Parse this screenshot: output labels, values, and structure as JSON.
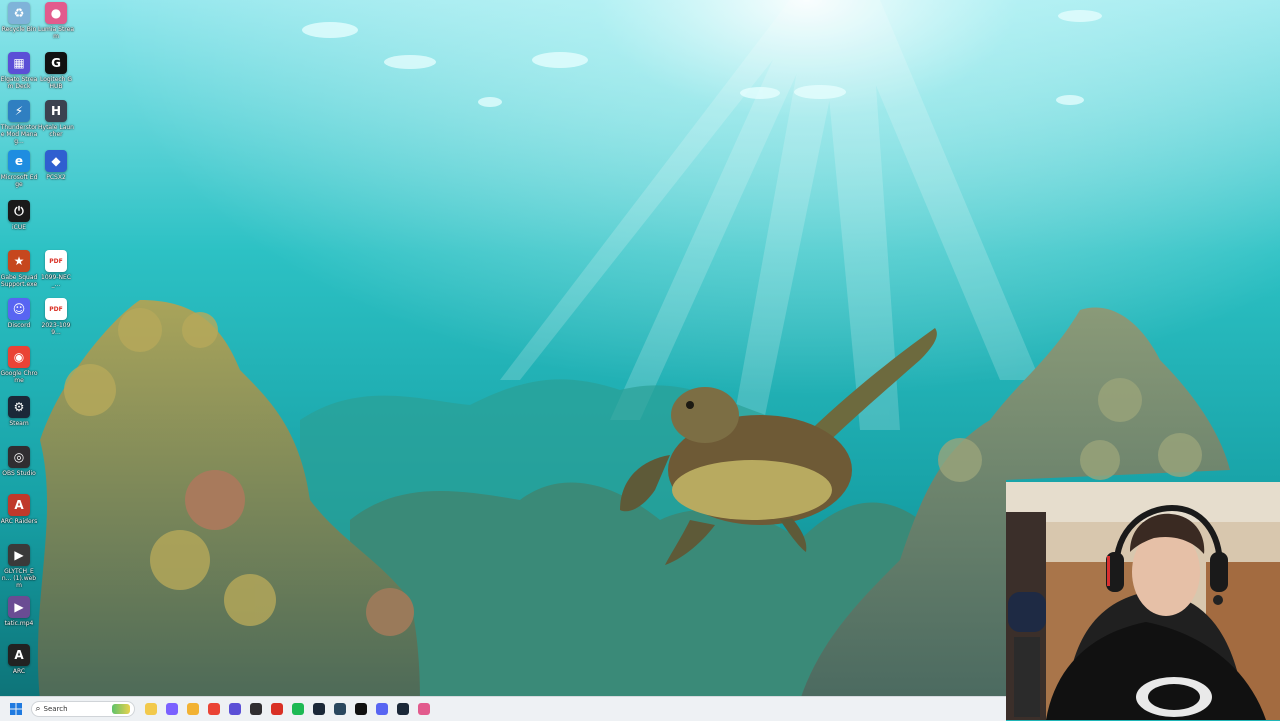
{
  "desktop": {
    "icons": [
      {
        "label": "Recycle Bin",
        "icon": "recycle-bin-icon",
        "color": "#7fb3d9"
      },
      {
        "label": "Lumia Stream",
        "icon": "lumia-pin-icon",
        "color": "#e25b8d"
      },
      {
        "label": "Elgato Stream Deck",
        "icon": "stream-deck-icon",
        "color": "#5b4fd6"
      },
      {
        "label": "Logitech G HUB",
        "icon": "logitech-g-icon",
        "color": "#111111"
      },
      {
        "label": "Thunderstore Mod Manag...",
        "icon": "thunderstore-icon",
        "color": "#2f7fc1"
      },
      {
        "label": "Hytale Launcher",
        "icon": "hytale-icon",
        "color": "#3b4250"
      },
      {
        "label": "Microsoft Edge",
        "icon": "edge-icon",
        "color": "#1f8de0"
      },
      {
        "label": "PCSX2",
        "icon": "pcsx2-icon",
        "color": "#2f5fd0"
      },
      {
        "label": "iCUE",
        "icon": "icue-icon",
        "color": "#1a1a1a"
      },
      {
        "label": "Gabe Squad Support.exe",
        "icon": "gabe-squad-icon",
        "color": "#c6471e"
      },
      {
        "label": "1099-NEC_...",
        "icon": "pdf-icon",
        "color": "#d93025"
      },
      {
        "label": "Discord",
        "icon": "discord-icon",
        "color": "#5865f2"
      },
      {
        "label": "2023-1099...",
        "icon": "pdf-icon",
        "color": "#d93025"
      },
      {
        "label": "Google Chrome",
        "icon": "chrome-icon",
        "color": "#ea4335"
      },
      {
        "label": "Steam",
        "icon": "steam-icon",
        "color": "#1b2838"
      },
      {
        "label": "OBS Studio",
        "icon": "obs-icon",
        "color": "#302e31"
      },
      {
        "label": "ARC Raiders",
        "icon": "arc-raiders-icon",
        "color": "#c0392b"
      },
      {
        "label": "GLYTCH_En... (1).webm",
        "icon": "video-file-icon",
        "color": "#3a3a3a"
      },
      {
        "label": "tatic.mp4",
        "icon": "video-file-icon",
        "color": "#6a4c93"
      },
      {
        "label": "ARC",
        "icon": "arc-icon",
        "color": "#222222"
      }
    ]
  },
  "taskbar": {
    "search_placeholder": "Search",
    "pinned": [
      {
        "name": "taskbar-file-explorer-icon",
        "color": "#f2c94c"
      },
      {
        "name": "taskbar-copilot-icon",
        "color": "#7b61ff"
      },
      {
        "name": "taskbar-folder-icon",
        "color": "#f2b233"
      },
      {
        "name": "taskbar-chrome-icon",
        "color": "#ea4335"
      },
      {
        "name": "taskbar-stream-deck-icon",
        "color": "#5b4fd6"
      },
      {
        "name": "taskbar-obs-icon",
        "color": "#302e31"
      },
      {
        "name": "taskbar-acrobat-icon",
        "color": "#d93025"
      },
      {
        "name": "taskbar-spotify-icon",
        "color": "#1db954"
      },
      {
        "name": "taskbar-steam-icon",
        "color": "#1b2838"
      },
      {
        "name": "taskbar-steam-2-icon",
        "color": "#2a475e"
      },
      {
        "name": "taskbar-logitech-icon",
        "color": "#111111"
      },
      {
        "name": "taskbar-discord-icon",
        "color": "#5865f2"
      },
      {
        "name": "taskbar-steam-3-icon",
        "color": "#1b2838"
      },
      {
        "name": "taskbar-lumia-icon",
        "color": "#e25b8d"
      }
    ]
  },
  "colors": {
    "water_top": "#8ee3ea",
    "water_mid": "#23b9be",
    "water_deep": "#0e7f86",
    "coral": "#6b7a52",
    "turtle": "#7a6a3a"
  }
}
